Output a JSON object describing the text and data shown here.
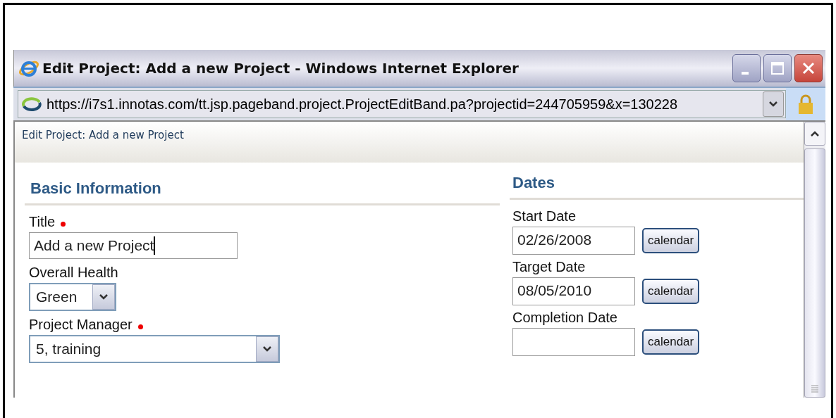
{
  "window": {
    "title": "Edit Project: Add a new Project - Windows Internet Explorer"
  },
  "address_bar": {
    "url": "https://i7s1.innotas.com/tt.jsp.pageband.project.ProjectEditBand.pa?projectid=244705959&x=130228"
  },
  "page_header": "Edit Project: Add a new Project",
  "basic_information": {
    "heading": "Basic Information",
    "fields": [
      {
        "kind": "text",
        "label": "Title",
        "required": true,
        "value": "Add a new Project"
      },
      {
        "kind": "select",
        "label": "Overall Health",
        "required": false,
        "value": "Green"
      },
      {
        "kind": "select",
        "label": "Project Manager",
        "required": true,
        "value": "5, training"
      }
    ]
  },
  "dates": {
    "heading": "Dates",
    "fields": [
      {
        "label": "Start Date",
        "value": "02/26/2008",
        "button": "calendar"
      },
      {
        "label": "Target Date",
        "value": "08/05/2010",
        "button": "calendar"
      },
      {
        "label": "Completion Date",
        "button": "calendar"
      }
    ]
  }
}
